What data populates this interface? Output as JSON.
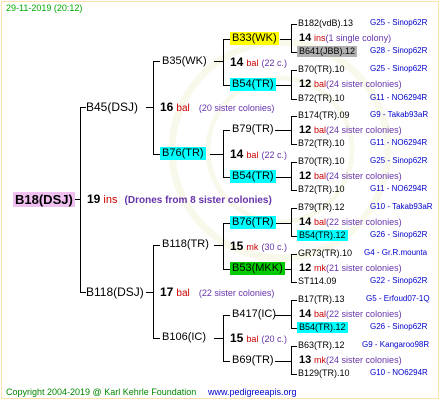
{
  "header": {
    "date": "29-11-2019 (20:12)"
  },
  "footer": {
    "copyright": "Copyright 2004-2019 @ Karl Kehrle Foundation",
    "url": "www.pedigreeapis.org"
  },
  "colors": {
    "red": "#cc0000",
    "purple": "#6633aa",
    "blue": "#0000cc",
    "yellow": "#ffff00",
    "cyan": "#00ffff",
    "green": "#00cc00",
    "gray": "#b0b0b0",
    "pink": "#f0c0f0"
  },
  "root": {
    "name": "B18(DSJ)",
    "num": "19",
    "unit": "ins",
    "note": "(Drones from 8 sister colonies)"
  },
  "gen1": [
    {
      "name": "B45(DSJ)",
      "num": "16",
      "unit": "bal",
      "note": "(20 sister colonies)"
    },
    {
      "name": "B118(DSJ)",
      "num": "17",
      "unit": "bal",
      "note": "(22 sister colonies)"
    }
  ],
  "gen2": [
    {
      "name": "B35(WK)"
    },
    {
      "name": "B76(TR)",
      "num": "14",
      "unit": "bal",
      "note": "(22 c.)"
    },
    {
      "name": "B118(TR)",
      "num": "15",
      "unit": "mk",
      "note": "(30 c.)"
    },
    {
      "name": "B106(IC)",
      "num": "15",
      "unit": "bal",
      "note": "(20 c.)"
    }
  ],
  "b35_detail": {
    "num": "14",
    "unit": "bal",
    "note": "(22 c.)"
  },
  "gen3": [
    {
      "name": "B33(WK)"
    },
    {
      "name": "B54(TR)"
    },
    {
      "name": "B79(TR)"
    },
    {
      "name": "B54(TR)"
    },
    {
      "name": "B76(TR)"
    },
    {
      "name": "B53(MKK)"
    },
    {
      "name": "B417(IC)"
    },
    {
      "name": "B69(TR)"
    }
  ],
  "gen3_details": [
    {
      "num": "14",
      "unit": "ins",
      "note": "(1 single colony)"
    },
    {
      "num": "12",
      "unit": "bal",
      "note": "(24 sister colonies)"
    },
    {
      "num": "12",
      "unit": "bal",
      "note": "(24 sister colonies)"
    },
    {
      "num": "12",
      "unit": "bal",
      "note": "(24 sister colonies)"
    },
    {
      "num": "14",
      "unit": "bal",
      "note": "(22 sister colonies)"
    },
    {
      "num": "12",
      "unit": "mk",
      "note": "(21 sister colonies)"
    },
    {
      "num": "14",
      "unit": "bal",
      "note": "(22 sister colonies)"
    },
    {
      "num": "13",
      "unit": "mk",
      "note": "(24 sister colonies)"
    }
  ],
  "gen4": [
    {
      "name": "B182(vdB).13",
      "info": "G25 - Sinop62R"
    },
    {
      "name": "B641(JBB).12",
      "info": "G28 - Sinop62R"
    },
    {
      "name": "B70(TR).10",
      "info": "G25 - Sinop62R"
    },
    {
      "name": "B72(TR).10",
      "info": "G11 - NO6294R"
    },
    {
      "name": "B174(TR).09",
      "info": "G9 - Takab93aR"
    },
    {
      "name": "B72(TR).10",
      "info": "G11 - NO6294R"
    },
    {
      "name": "B70(TR).10",
      "info": "G25 - Sinop62R"
    },
    {
      "name": "B72(TR).10",
      "info": "G11 - NO6294R"
    },
    {
      "name": "B79(TR).12",
      "info": "G10 - Takab93aR"
    },
    {
      "name": "B54(TR).12",
      "info": "G26 - Sinop62R"
    },
    {
      "name": "GR73(TR).10",
      "info": "G4 - Gr.R.mounta"
    },
    {
      "name": "ST114.09",
      "info": "G22 - Sinop62R"
    },
    {
      "name": "B17(TR).13",
      "info": "G5 - Erfoud07-1Q"
    },
    {
      "name": "B54(TR).12",
      "info": "G26 - Sinop62R"
    },
    {
      "name": "B63(TR).12",
      "info": "G9 - Kangaroo98R"
    },
    {
      "name": "B129(TR).10",
      "info": "G10 - NO6294R"
    }
  ]
}
